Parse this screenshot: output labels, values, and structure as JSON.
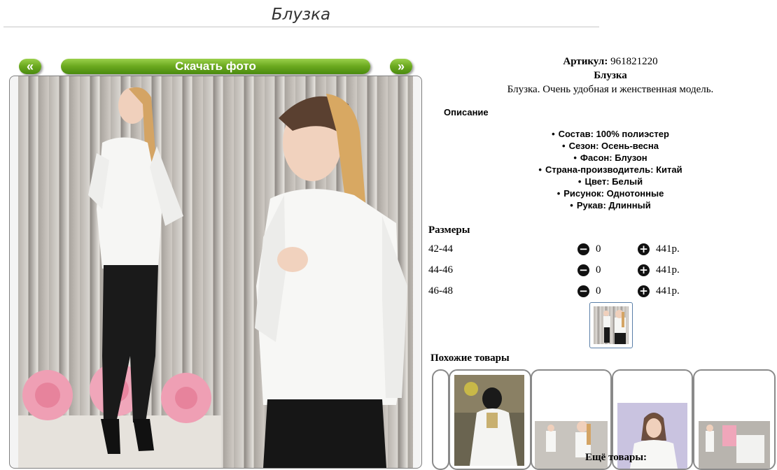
{
  "header": {
    "title": "Блузка"
  },
  "gallery": {
    "prev_label": "«",
    "download_label": "Скачать фото",
    "next_label": "»"
  },
  "product": {
    "sku_label": "Артикул:",
    "sku_value": "961821220",
    "name": "Блузка",
    "short_description": "Блузка. Очень удобная и женственная модель.",
    "description_title": "Описание",
    "properties": [
      "Состав: 100% полиэстер",
      "Сезон: Осень-весна",
      "Фасон: Блузон",
      "Страна-производитель: Китай",
      "Цвет: Белый",
      "Рисунок: Однотонные",
      "Рукав: Длинный"
    ]
  },
  "sizes": {
    "title": "Размеры",
    "rows": [
      {
        "size": "42-44",
        "qty": "0",
        "price": "441р."
      },
      {
        "size": "44-46",
        "qty": "0",
        "price": "441р."
      },
      {
        "size": "46-48",
        "qty": "0",
        "price": "441р."
      }
    ]
  },
  "similar": {
    "title": "Похожие товары",
    "more_label": "Ещё товары:"
  },
  "icons": {
    "minus": "minus-circle-icon",
    "plus": "plus-circle-icon"
  },
  "colors": {
    "accent_green": "#6aa81e",
    "thumb_border": "#5a7fa8"
  }
}
